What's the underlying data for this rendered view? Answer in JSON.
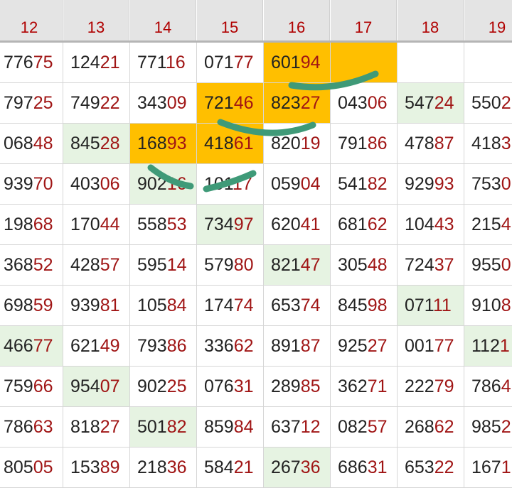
{
  "colors": {
    "header_bg": "#e4e4e4",
    "header_text": "#b00000",
    "digit_dark": "#222222",
    "digit_red": "#a01515",
    "highlight_orange": "#ffbf00",
    "highlight_green": "#e6f3e2",
    "annotation_stroke": "#3f9a78"
  },
  "columns": [
    "12",
    "13",
    "14",
    "15",
    "16",
    "17",
    "18",
    "19"
  ],
  "rows": [
    [
      {
        "v": "77675",
        "hl": ""
      },
      {
        "v": "12421",
        "hl": ""
      },
      {
        "v": "77116",
        "hl": ""
      },
      {
        "v": "07177",
        "hl": ""
      },
      {
        "v": "60194",
        "hl": "orange"
      },
      {
        "v": "",
        "hl": "orange"
      },
      {
        "v": "",
        "hl": ""
      },
      {
        "v": "",
        "hl": ""
      }
    ],
    [
      {
        "v": "79725",
        "hl": ""
      },
      {
        "v": "74922",
        "hl": ""
      },
      {
        "v": "34309",
        "hl": ""
      },
      {
        "v": "72146",
        "hl": "orange"
      },
      {
        "v": "82327",
        "hl": "orange"
      },
      {
        "v": "04306",
        "hl": ""
      },
      {
        "v": "54724",
        "hl": "green"
      },
      {
        "v": "5502",
        "hl": ""
      }
    ],
    [
      {
        "v": "06848",
        "hl": ""
      },
      {
        "v": "84528",
        "hl": "green"
      },
      {
        "v": "16893",
        "hl": "orange"
      },
      {
        "v": "41861",
        "hl": "orange"
      },
      {
        "v": "82019",
        "hl": ""
      },
      {
        "v": "79186",
        "hl": ""
      },
      {
        "v": "47887",
        "hl": ""
      },
      {
        "v": "4183",
        "hl": ""
      }
    ],
    [
      {
        "v": "93970",
        "hl": ""
      },
      {
        "v": "40306",
        "hl": ""
      },
      {
        "v": "90216",
        "hl": "green"
      },
      {
        "v": "10117",
        "hl": ""
      },
      {
        "v": "05904",
        "hl": ""
      },
      {
        "v": "54182",
        "hl": ""
      },
      {
        "v": "92993",
        "hl": ""
      },
      {
        "v": "7530",
        "hl": ""
      }
    ],
    [
      {
        "v": "19868",
        "hl": ""
      },
      {
        "v": "17044",
        "hl": ""
      },
      {
        "v": "55853",
        "hl": ""
      },
      {
        "v": "73497",
        "hl": "green"
      },
      {
        "v": "62041",
        "hl": ""
      },
      {
        "v": "68162",
        "hl": ""
      },
      {
        "v": "10443",
        "hl": ""
      },
      {
        "v": "2154",
        "hl": ""
      }
    ],
    [
      {
        "v": "36852",
        "hl": ""
      },
      {
        "v": "42857",
        "hl": ""
      },
      {
        "v": "59514",
        "hl": ""
      },
      {
        "v": "57980",
        "hl": ""
      },
      {
        "v": "82147",
        "hl": "green"
      },
      {
        "v": "30548",
        "hl": ""
      },
      {
        "v": "72437",
        "hl": ""
      },
      {
        "v": "9550",
        "hl": ""
      }
    ],
    [
      {
        "v": "69859",
        "hl": ""
      },
      {
        "v": "93981",
        "hl": ""
      },
      {
        "v": "10584",
        "hl": ""
      },
      {
        "v": "17474",
        "hl": ""
      },
      {
        "v": "65374",
        "hl": ""
      },
      {
        "v": "84598",
        "hl": ""
      },
      {
        "v": "07111",
        "hl": "green"
      },
      {
        "v": "9108",
        "hl": ""
      }
    ],
    [
      {
        "v": "46677",
        "hl": "green"
      },
      {
        "v": "62149",
        "hl": ""
      },
      {
        "v": "79386",
        "hl": ""
      },
      {
        "v": "33662",
        "hl": ""
      },
      {
        "v": "89187",
        "hl": ""
      },
      {
        "v": "92527",
        "hl": ""
      },
      {
        "v": "00177",
        "hl": ""
      },
      {
        "v": "1121",
        "hl": "green"
      }
    ],
    [
      {
        "v": "75966",
        "hl": ""
      },
      {
        "v": "95407",
        "hl": "green"
      },
      {
        "v": "90225",
        "hl": ""
      },
      {
        "v": "07631",
        "hl": ""
      },
      {
        "v": "28985",
        "hl": ""
      },
      {
        "v": "36271",
        "hl": ""
      },
      {
        "v": "22279",
        "hl": ""
      },
      {
        "v": "7864",
        "hl": ""
      }
    ],
    [
      {
        "v": "78663",
        "hl": ""
      },
      {
        "v": "81827",
        "hl": ""
      },
      {
        "v": "50182",
        "hl": "green"
      },
      {
        "v": "85984",
        "hl": ""
      },
      {
        "v": "63712",
        "hl": ""
      },
      {
        "v": "08257",
        "hl": ""
      },
      {
        "v": "26862",
        "hl": ""
      },
      {
        "v": "9852",
        "hl": ""
      }
    ],
    [
      {
        "v": "80505",
        "hl": ""
      },
      {
        "v": "15389",
        "hl": ""
      },
      {
        "v": "21836",
        "hl": ""
      },
      {
        "v": "58421",
        "hl": ""
      },
      {
        "v": "26736",
        "hl": "green"
      },
      {
        "v": "68631",
        "hl": ""
      },
      {
        "v": "65322",
        "hl": ""
      },
      {
        "v": "1671",
        "hl": ""
      }
    ]
  ]
}
